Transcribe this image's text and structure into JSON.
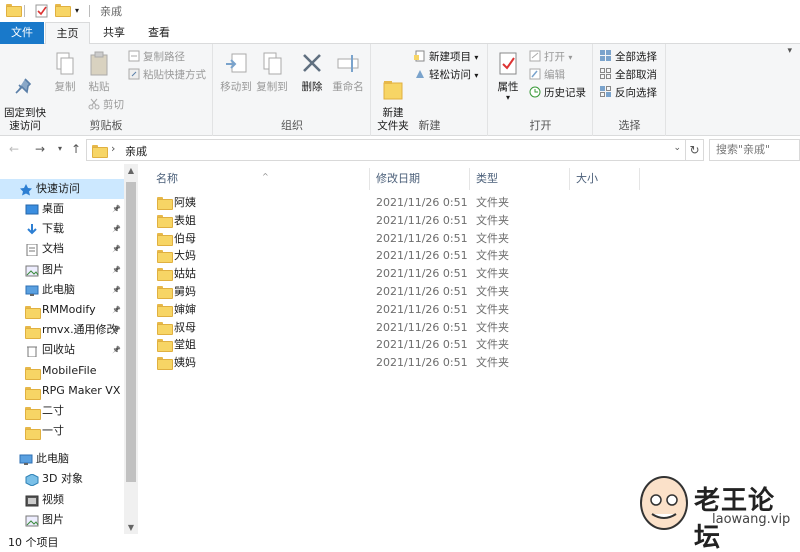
{
  "titlebar": {
    "title": "亲戚"
  },
  "ribbon_tabs": {
    "file": "文件",
    "home": "主页",
    "share": "共享",
    "view": "查看"
  },
  "ribbon": {
    "clipboard": {
      "pin_quick_access": "固定到快\n速访问",
      "copy": "复制",
      "paste": "粘贴",
      "copy_path": "复制路径",
      "paste_shortcut": "粘贴快捷方式",
      "cut": "剪切",
      "label": "剪贴板"
    },
    "organize": {
      "move_to": "移动到",
      "copy_to": "复制到",
      "delete": "删除",
      "rename": "重命名",
      "label": "组织"
    },
    "new": {
      "new_folder": "新建\n文件夹",
      "new_item": "新建项目",
      "easy_access": "轻松访问",
      "label": "新建"
    },
    "open": {
      "properties": "属性",
      "open": "打开",
      "edit": "编辑",
      "history": "历史记录",
      "label": "打开"
    },
    "select": {
      "select_all": "全部选择",
      "select_none": "全部取消",
      "invert": "反向选择",
      "label": "选择"
    }
  },
  "address": {
    "current_folder": "亲戚",
    "search_placeholder": "搜索\"亲戚\""
  },
  "navpane": {
    "quick_access": "快速访问",
    "items": [
      {
        "label": "桌面",
        "icon": "desktop-icon",
        "pinned": true
      },
      {
        "label": "下载",
        "icon": "download-icon",
        "pinned": true
      },
      {
        "label": "文档",
        "icon": "document-icon",
        "pinned": true
      },
      {
        "label": "图片",
        "icon": "picture-icon",
        "pinned": true
      },
      {
        "label": "此电脑",
        "icon": "computer-icon",
        "pinned": true
      },
      {
        "label": "RMModify",
        "icon": "folder-icon",
        "pinned": true
      },
      {
        "label": "rmvx.通用修改",
        "icon": "folder-icon",
        "pinned": true
      },
      {
        "label": "回收站",
        "icon": "recycle-bin-icon",
        "pinned": true
      },
      {
        "label": "MobileFile",
        "icon": "folder-icon",
        "pinned": false
      },
      {
        "label": "RPG Maker VX A",
        "icon": "folder-icon",
        "pinned": false
      },
      {
        "label": "二寸",
        "icon": "folder-icon",
        "pinned": false
      },
      {
        "label": "一寸",
        "icon": "folder-icon",
        "pinned": false
      }
    ],
    "this_pc": "此电脑",
    "pc_items": [
      {
        "label": "3D 对象",
        "icon": "3d-objects-icon"
      },
      {
        "label": "视频",
        "icon": "video-icon"
      },
      {
        "label": "图片",
        "icon": "picture-icon"
      }
    ]
  },
  "filelist": {
    "columns": {
      "name": "名称",
      "date": "修改日期",
      "type": "类型",
      "size": "大小"
    },
    "rows": [
      {
        "name": "阿姨",
        "date": "2021/11/26 0:51",
        "type": "文件夹"
      },
      {
        "name": "表姐",
        "date": "2021/11/26 0:51",
        "type": "文件夹"
      },
      {
        "name": "伯母",
        "date": "2021/11/26 0:51",
        "type": "文件夹"
      },
      {
        "name": "大妈",
        "date": "2021/11/26 0:51",
        "type": "文件夹"
      },
      {
        "name": "姑姑",
        "date": "2021/11/26 0:51",
        "type": "文件夹"
      },
      {
        "name": "舅妈",
        "date": "2021/11/26 0:51",
        "type": "文件夹"
      },
      {
        "name": "婶婶",
        "date": "2021/11/26 0:51",
        "type": "文件夹"
      },
      {
        "name": "叔母",
        "date": "2021/11/26 0:51",
        "type": "文件夹"
      },
      {
        "name": "堂姐",
        "date": "2021/11/26 0:51",
        "type": "文件夹"
      },
      {
        "name": "姨妈",
        "date": "2021/11/26 0:51",
        "type": "文件夹"
      }
    ]
  },
  "statusbar": {
    "count": "10 个项目"
  },
  "watermark": {
    "title": "老王论坛",
    "url": "laowang.vip"
  },
  "colors": {
    "accent": "#1979ca",
    "selection": "#cce8ff",
    "folder": "#f7d565"
  }
}
